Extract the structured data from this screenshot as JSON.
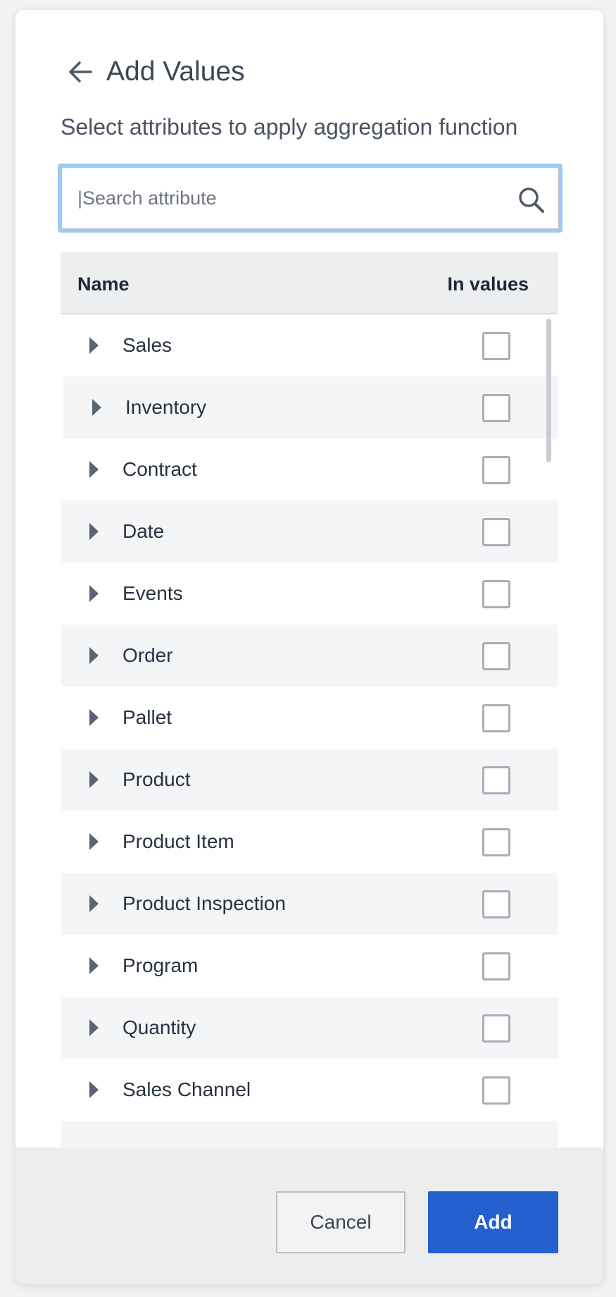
{
  "dialog": {
    "title": "Add Values",
    "subtitle": "Select attributes to apply aggregation function",
    "back_icon": "arrow-left-icon"
  },
  "search": {
    "placeholder": "|Search attribute",
    "value": "",
    "icon": "search-icon"
  },
  "table": {
    "columns": {
      "name": "Name",
      "in_values": "In values"
    },
    "rows": [
      {
        "label": "Sales",
        "checked": false
      },
      {
        "label": "Inventory",
        "checked": false
      },
      {
        "label": "Contract",
        "checked": false
      },
      {
        "label": "Date",
        "checked": false
      },
      {
        "label": "Events",
        "checked": false
      },
      {
        "label": "Order",
        "checked": false
      },
      {
        "label": "Pallet",
        "checked": false
      },
      {
        "label": "Product",
        "checked": false
      },
      {
        "label": "Product Item",
        "checked": false
      },
      {
        "label": "Product Inspection",
        "checked": false
      },
      {
        "label": "Program",
        "checked": false
      },
      {
        "label": "Quantity",
        "checked": false
      },
      {
        "label": "Sales Channel",
        "checked": false
      }
    ]
  },
  "footer": {
    "cancel_label": "Cancel",
    "add_label": "Add"
  },
  "colors": {
    "accent": "#2461cf",
    "focus_ring": "#9bcbf5",
    "row_alt": "#f4f5f7",
    "header_bg": "#eceef0"
  }
}
